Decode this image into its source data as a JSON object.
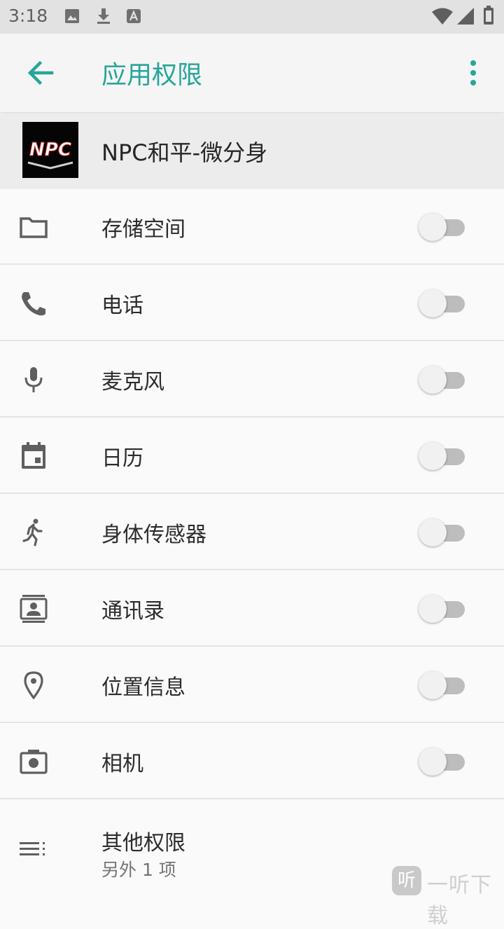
{
  "status_bar": {
    "time": "3:18",
    "icons": [
      "gallery-notification-icon",
      "download-notification-icon",
      "app-notification-icon",
      "wifi-icon",
      "cell-signal-icon",
      "battery-icon"
    ]
  },
  "toolbar": {
    "title": "应用权限",
    "back_icon": "arrow-back-icon",
    "more_icon": "more-vert-icon"
  },
  "app": {
    "name": "NPC和平-微分身",
    "icon_text": "NPC"
  },
  "permissions": [
    {
      "label": "存储空间",
      "icon": "folder-icon",
      "enabled": false
    },
    {
      "label": "电话",
      "icon": "phone-icon",
      "enabled": false
    },
    {
      "label": "麦克风",
      "icon": "microphone-icon",
      "enabled": false
    },
    {
      "label": "日历",
      "icon": "calendar-icon",
      "enabled": false
    },
    {
      "label": "身体传感器",
      "icon": "running-person-icon",
      "enabled": false
    },
    {
      "label": "通讯录",
      "icon": "contacts-icon",
      "enabled": false
    },
    {
      "label": "位置信息",
      "icon": "location-pin-icon",
      "enabled": false
    },
    {
      "label": "相机",
      "icon": "camera-icon",
      "enabled": false
    }
  ],
  "other": {
    "label": "其他权限",
    "sub": "另外 1 项",
    "icon": "list-icon"
  },
  "watermark": {
    "badge": "听",
    "text": "一听下载"
  },
  "colors": {
    "accent": "#26a69a",
    "toolbar_bg": "#f5f5f5",
    "status_bar_bg": "#e2e2e2",
    "app_header_bg": "#ececec"
  }
}
